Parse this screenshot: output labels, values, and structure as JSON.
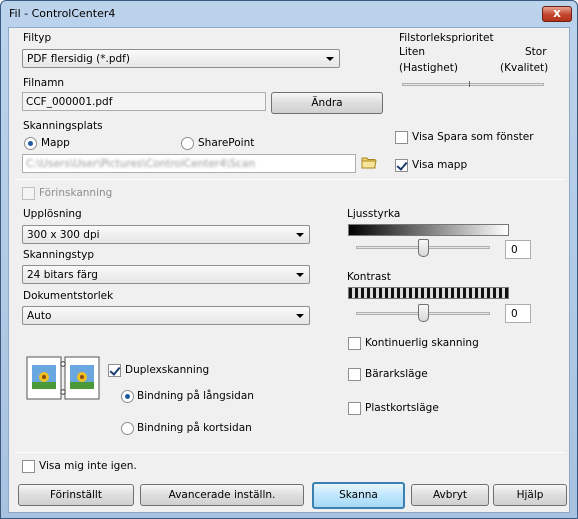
{
  "window": {
    "title": "Fil - ControlCenter4",
    "close_glyph": "x"
  },
  "file_type": {
    "label": "Filtyp",
    "value": "PDF flersidig (*.pdf)"
  },
  "file_size": {
    "label": "Filstorleksprioritet",
    "left_label": "Liten",
    "right_label": "Stor",
    "left_sub": "(Hastighet)",
    "right_sub": "(Kvalitet)",
    "position": 0.5
  },
  "file_name": {
    "label": "Filnamn",
    "value": "CCF_000001.pdf",
    "change_button": "Ändra"
  },
  "scan_location": {
    "label": "Skanningsplats",
    "option_folder": "Mapp",
    "option_sharepoint": "SharePoint",
    "path": "C:\\Users\\User\\Pictures\\ControlCenter4\\Scan",
    "folder_icon": "folder-icon"
  },
  "show_save_as": {
    "label": "Visa Spara som fönster",
    "checked": false
  },
  "show_folder": {
    "label": "Visa mapp",
    "checked": true
  },
  "prescan": {
    "label": "Förinskanning",
    "checked": false,
    "enabled": false
  },
  "resolution": {
    "label": "Upplösning",
    "value": "300 x 300 dpi"
  },
  "scan_type": {
    "label": "Skanningstyp",
    "value": "24 bitars färg"
  },
  "document_size": {
    "label": "Dokumentstorlek",
    "value": "Auto"
  },
  "brightness": {
    "label": "Ljusstyrka",
    "value": "0",
    "position": 0.5
  },
  "contrast": {
    "label": "Kontrast",
    "value": "0",
    "position": 0.5
  },
  "duplex": {
    "label": "Duplexskanning",
    "checked": true,
    "icon": "duplex-pages-icon",
    "option_long": "Bindning på långsidan",
    "option_short": "Bindning på kortsidan"
  },
  "continuous": {
    "label": "Kontinuerlig skanning",
    "checked": false
  },
  "carrier": {
    "label": "Bärarksläge",
    "checked": false
  },
  "plastic_card": {
    "label": "Plastkortsläge",
    "checked": false
  },
  "dont_show": {
    "label": "Visa mig inte igen.",
    "checked": false
  },
  "buttons": {
    "default": "Förinställt",
    "advanced": "Avancerade inställn.",
    "scan": "Skanna",
    "cancel": "Avbryt",
    "help": "Hjälp"
  }
}
